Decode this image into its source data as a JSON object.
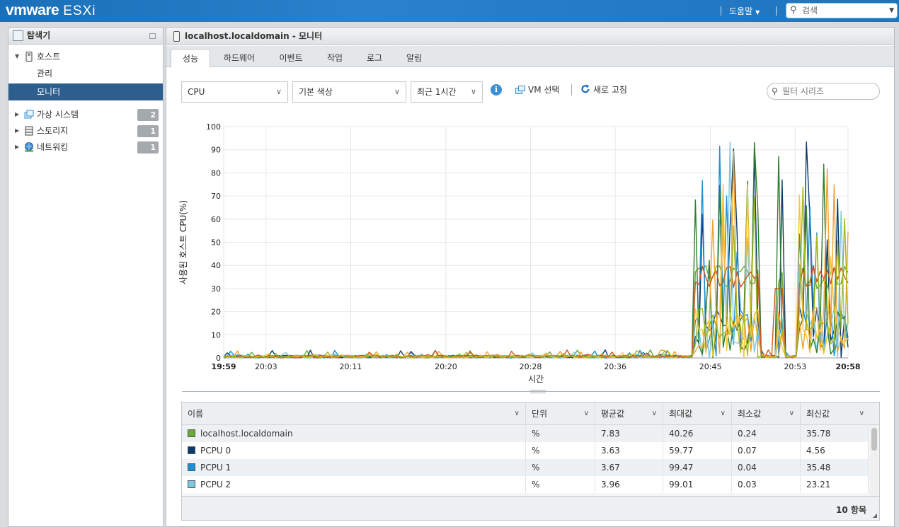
{
  "topbar": {
    "brand_vm": "vmware",
    "brand_product": "ESXi",
    "help_label": "도움말",
    "search_placeholder": "검색"
  },
  "navigator": {
    "title": "탐색기",
    "host_label": "호스트",
    "host_children": [
      {
        "label": "관리",
        "selected": false
      },
      {
        "label": "모니터",
        "selected": true
      }
    ],
    "groups": [
      {
        "label": "가상 시스템",
        "count": "2",
        "icon": "vm-icon"
      },
      {
        "label": "스토리지",
        "count": "1",
        "icon": "storage-icon"
      },
      {
        "label": "네트워킹",
        "count": "1",
        "icon": "network-icon"
      }
    ]
  },
  "main": {
    "title": "localhost.localdomain - 모니터",
    "tabs": [
      "성능",
      "하드웨어",
      "이벤트",
      "작업",
      "로그",
      "알림"
    ],
    "active_tab": 0
  },
  "toolbar": {
    "metric": "CPU",
    "color_scheme": "기본 색상",
    "range": "최근 1시간",
    "vm_select": "VM 선택",
    "refresh": "새로 고침",
    "filter_placeholder": "필터 시리즈"
  },
  "chart_data": {
    "type": "line",
    "xlabel": "시간",
    "ylabel": "사용된 호스트 CPU(%)",
    "ylim": [
      0,
      100
    ],
    "yticks": [
      0,
      10,
      20,
      30,
      40,
      50,
      60,
      70,
      80,
      90,
      100
    ],
    "xtick_labels": [
      "19:59",
      "20:03",
      "20:11",
      "20:20",
      "20:28",
      "20:36",
      "20:45",
      "20:53",
      "20:58"
    ],
    "xtick_minutes": [
      0,
      4,
      12,
      21,
      29,
      37,
      46,
      54,
      59
    ],
    "series": [
      {
        "name": "localhost.localdomain",
        "color": "#6aa837"
      },
      {
        "name": "PCPU 0",
        "color": "#0d3a6b"
      },
      {
        "name": "PCPU 1",
        "color": "#1b8fd2"
      },
      {
        "name": "PCPU 2",
        "color": "#7dc7e0"
      },
      {
        "color": "#2f7d2d"
      },
      {
        "color": "#f0a22c"
      },
      {
        "color": "#f7c534"
      },
      {
        "color": "#c9571e"
      },
      {
        "color": "#a3b81e"
      }
    ]
  },
  "table": {
    "columns": [
      "이름",
      "단위",
      "평균값",
      "최대값",
      "최소값",
      "최신값"
    ],
    "rows": [
      {
        "name": "localhost.localdomain",
        "color": "#6aa837",
        "unit": "%",
        "avg": "7.83",
        "max": "40.26",
        "min": "0.24",
        "latest": "35.78"
      },
      {
        "name": "PCPU 0",
        "color": "#0d3a6b",
        "unit": "%",
        "avg": "3.63",
        "max": "59.77",
        "min": "0.07",
        "latest": "4.56"
      },
      {
        "name": "PCPU 1",
        "color": "#1b8fd2",
        "unit": "%",
        "avg": "3.67",
        "max": "99.47",
        "min": "0.04",
        "latest": "35.48"
      },
      {
        "name": "PCPU 2",
        "color": "#7dc7e0",
        "unit": "%",
        "avg": "3.96",
        "max": "99.01",
        "min": "0.03",
        "latest": "23.21"
      }
    ],
    "item_count": "10 항목"
  }
}
